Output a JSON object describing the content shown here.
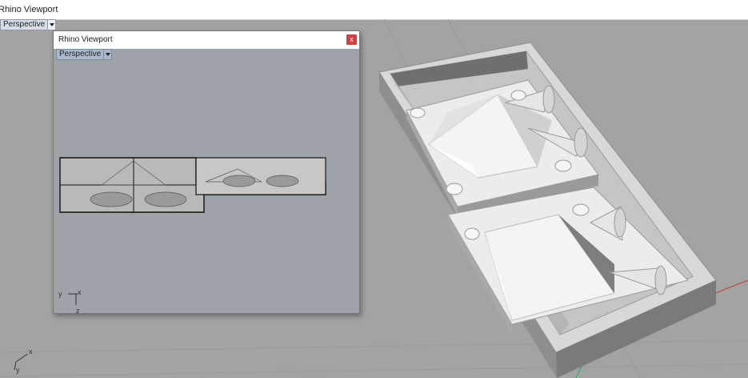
{
  "app": {
    "window_title": "Rhino Viewport"
  },
  "main_viewport": {
    "view_name": "Perspective",
    "axes": {
      "x": "x",
      "y": "y"
    }
  },
  "floating_viewport": {
    "title": "Rhino Viewport",
    "close_label": "x",
    "view_name": "Perspective",
    "axes": {
      "x": "x",
      "y": "y",
      "z": "z"
    }
  },
  "colors": {
    "viewport_bg": "#a3a3a3",
    "floating_bg": "#9ea3aa",
    "x_axis": "#c0392b",
    "y_axis": "#27ae60"
  }
}
